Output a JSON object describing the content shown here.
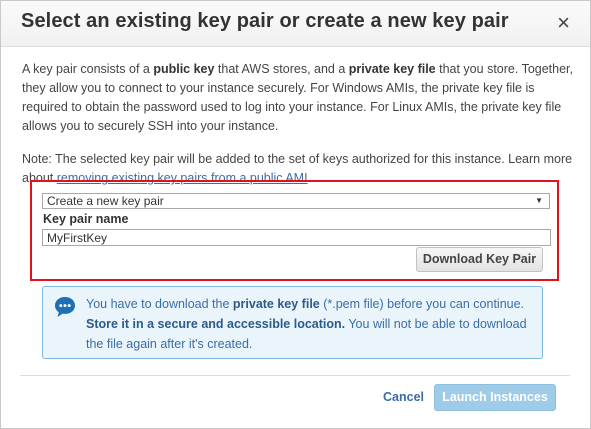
{
  "dialog": {
    "title": "Select an existing key pair or create a new key pair",
    "close_symbol": "×"
  },
  "intro": {
    "t1": "A key pair consists of a ",
    "b1": "public key",
    "t2": " that AWS stores, and a ",
    "b2": "private key file",
    "t3": " that you store. Together, they allow you to connect to your instance securely. For Windows AMIs, the private key file is required to obtain the password used to log into your instance. For Linux AMIs, the private key file allows you to securely SSH into your instance."
  },
  "note": {
    "text": "Note: The selected key pair will be added to the set of keys authorized for this instance. Learn more about ",
    "link": "removing existing key pairs from a public AMI",
    "end": "."
  },
  "form": {
    "select_value": "Create a new key pair",
    "key_pair_label": "Key pair name",
    "key_pair_value": "MyFirstKey",
    "download_label": "Download Key Pair"
  },
  "info": {
    "icon": "chat-bubble-icon",
    "t1": "You have to download the ",
    "b1": "private key file",
    "t2": " (*.pem file) before you can continue. ",
    "b2": "Store it in a secure and accessible location.",
    "t3": " You will not be able to download the file again after it's created."
  },
  "footer": {
    "cancel_label": "Cancel",
    "launch_label": "Launch Instances"
  },
  "colors": {
    "highlight_border": "#e0131c",
    "link": "#3a6ea5",
    "info_bg": "#eaf4fb",
    "launch_bg": "#9ecbe8"
  }
}
